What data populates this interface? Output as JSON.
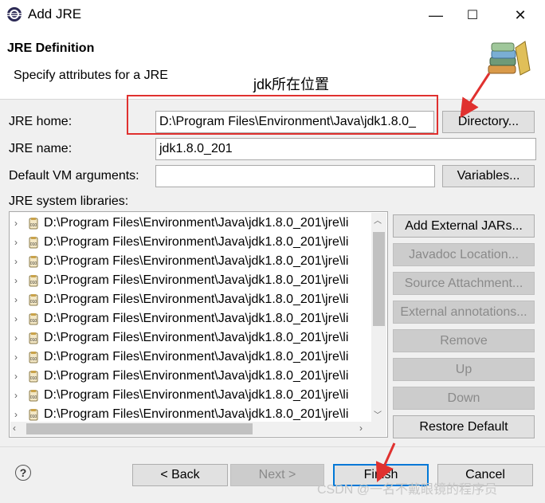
{
  "window": {
    "title": "Add JRE",
    "minimize_glyph": "—",
    "maximize_glyph": "☐",
    "close_glyph": "✕"
  },
  "header": {
    "title": "JRE Definition",
    "description": "Specify attributes for a JRE",
    "icon": "library-books-icon"
  },
  "form": {
    "jre_home_label": "JRE home:",
    "jre_home_value": "D:\\Program Files\\Environment\\Java\\jdk1.8.0_",
    "directory_button": "Directory...",
    "jre_name_label": "JRE name:",
    "jre_name_value": "jdk1.8.0_201",
    "vm_args_label": "Default VM arguments:",
    "vm_args_value": "",
    "variables_button": "Variables...",
    "libraries_label": "JRE system libraries:"
  },
  "libraries": {
    "items": [
      "D:\\Program Files\\Environment\\Java\\jdk1.8.0_201\\jre\\li",
      "D:\\Program Files\\Environment\\Java\\jdk1.8.0_201\\jre\\li",
      "D:\\Program Files\\Environment\\Java\\jdk1.8.0_201\\jre\\li",
      "D:\\Program Files\\Environment\\Java\\jdk1.8.0_201\\jre\\li",
      "D:\\Program Files\\Environment\\Java\\jdk1.8.0_201\\jre\\li",
      "D:\\Program Files\\Environment\\Java\\jdk1.8.0_201\\jre\\li",
      "D:\\Program Files\\Environment\\Java\\jdk1.8.0_201\\jre\\li",
      "D:\\Program Files\\Environment\\Java\\jdk1.8.0_201\\jre\\li",
      "D:\\Program Files\\Environment\\Java\\jdk1.8.0_201\\jre\\li",
      "D:\\Program Files\\Environment\\Java\\jdk1.8.0_201\\jre\\li",
      "D:\\Program Files\\Environment\\Java\\jdk1.8.0_201\\jre\\li"
    ]
  },
  "side_buttons": {
    "add_external_jars": "Add External JARs...",
    "javadoc_location": "Javadoc Location...",
    "source_attachment": "Source Attachment...",
    "external_annotations": "External annotations...",
    "remove": "Remove",
    "up": "Up",
    "down": "Down",
    "restore_default": "Restore Default"
  },
  "footer": {
    "help_glyph": "?",
    "back_button": "< Back",
    "next_button": "Next >",
    "finish_button": "Finish",
    "cancel_button": "Cancel"
  },
  "annotation": {
    "note": "jdk所在位置",
    "watermark": "CSDN @一名不戴眼镜的程序员",
    "color": "#e0312f"
  }
}
